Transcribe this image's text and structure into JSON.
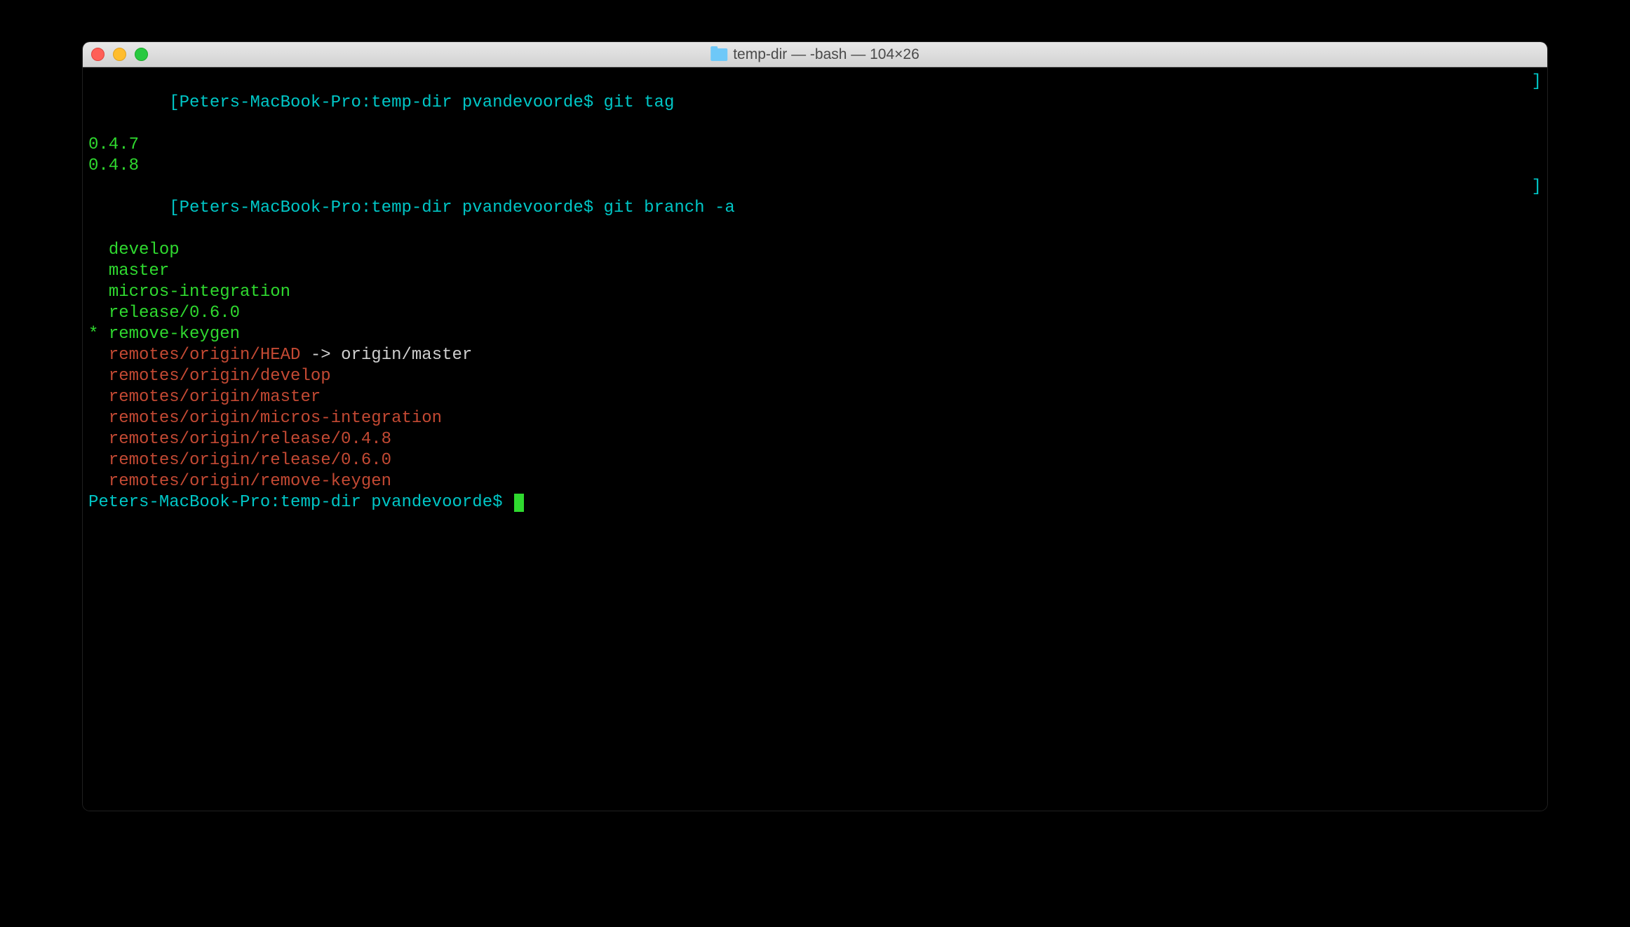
{
  "window": {
    "title": "temp-dir — -bash — 104×26"
  },
  "prompt": "Peters-MacBook-Pro:temp-dir pvandevoorde$ ",
  "commands": {
    "tag": "git tag",
    "branch": "git branch -a"
  },
  "tags": [
    "0.4.7",
    "0.4.8"
  ],
  "branches": {
    "local": [
      {
        "prefix": "  ",
        "name": "develop",
        "current": false
      },
      {
        "prefix": "  ",
        "name": "master",
        "current": false
      },
      {
        "prefix": "  ",
        "name": "micros-integration",
        "current": false
      },
      {
        "prefix": "  ",
        "name": "release/0.6.0",
        "current": false
      },
      {
        "prefix": "* ",
        "name": "remove-keygen",
        "current": true
      }
    ],
    "head_ref": {
      "indent": "  ",
      "ref": "remotes/origin/HEAD",
      "arrow": " -> ",
      "target": "origin/master"
    },
    "remotes": [
      "  remotes/origin/develop",
      "  remotes/origin/master",
      "  remotes/origin/micros-integration",
      "  remotes/origin/release/0.4.8",
      "  remotes/origin/release/0.6.0",
      "  remotes/origin/remove-keygen"
    ]
  },
  "brackets": {
    "open": "[",
    "close": "]"
  }
}
